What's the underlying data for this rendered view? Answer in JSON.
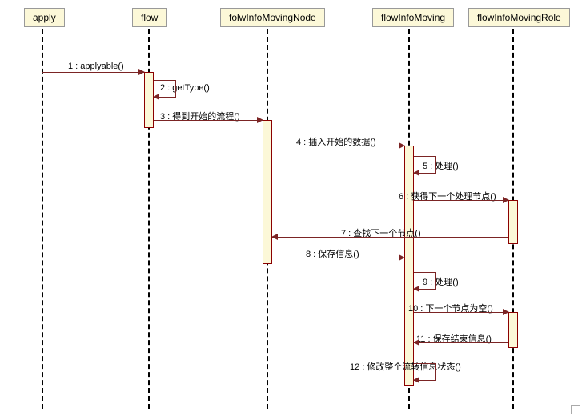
{
  "participants": {
    "p1": "apply",
    "p2": "flow",
    "p3": "folwInfoMovingNode",
    "p4": "flowInfoMoving",
    "p5": "flowInfoMovingRole"
  },
  "messages": {
    "m1": "1 : applyable()",
    "m2": "2 : getType()",
    "m3": "3 : 得到开始的流程()",
    "m4": "4 : 插入开始的数据()",
    "m5": "5 : 处理()",
    "m6": "6 : 获得下一个处理节点()",
    "m7": "7 : 查找下一个节点()",
    "m8": "8 : 保存信息()",
    "m9": "9 : 处理()",
    "m10": "10 : 下一个节点为空()",
    "m11": "11 : 保存结束信息()",
    "m12": "12 : 修改整个流转信息状态()"
  },
  "chart_data": {
    "type": "sequence-diagram",
    "participants": [
      "apply",
      "flow",
      "folwInfoMovingNode",
      "flowInfoMoving",
      "flowInfoMovingRole"
    ],
    "messages": [
      {
        "n": 1,
        "from": "apply",
        "to": "flow",
        "label": "applyable()"
      },
      {
        "n": 2,
        "from": "flow",
        "to": "flow",
        "label": "getType()",
        "self": true
      },
      {
        "n": 3,
        "from": "flow",
        "to": "folwInfoMovingNode",
        "label": "得到开始的流程()"
      },
      {
        "n": 4,
        "from": "folwInfoMovingNode",
        "to": "flowInfoMoving",
        "label": "插入开始的数据()"
      },
      {
        "n": 5,
        "from": "flowInfoMoving",
        "to": "flowInfoMoving",
        "label": "处理()",
        "self": true
      },
      {
        "n": 6,
        "from": "flowInfoMoving",
        "to": "flowInfoMovingRole",
        "label": "获得下一个处理节点()"
      },
      {
        "n": 7,
        "from": "flowInfoMovingRole",
        "to": "folwInfoMovingNode",
        "label": "查找下一个节点()",
        "return": true
      },
      {
        "n": 8,
        "from": "folwInfoMovingNode",
        "to": "flowInfoMoving",
        "label": "保存信息()"
      },
      {
        "n": 9,
        "from": "flowInfoMoving",
        "to": "flowInfoMoving",
        "label": "处理()",
        "self": true
      },
      {
        "n": 10,
        "from": "flowInfoMoving",
        "to": "flowInfoMovingRole",
        "label": "下一个节点为空()"
      },
      {
        "n": 11,
        "from": "flowInfoMovingRole",
        "to": "flowInfoMoving",
        "label": "保存结束信息()",
        "return": true
      },
      {
        "n": 12,
        "from": "flowInfoMoving",
        "to": "flowInfoMoving",
        "label": "修改整个流转信息状态()",
        "self": true
      }
    ]
  }
}
